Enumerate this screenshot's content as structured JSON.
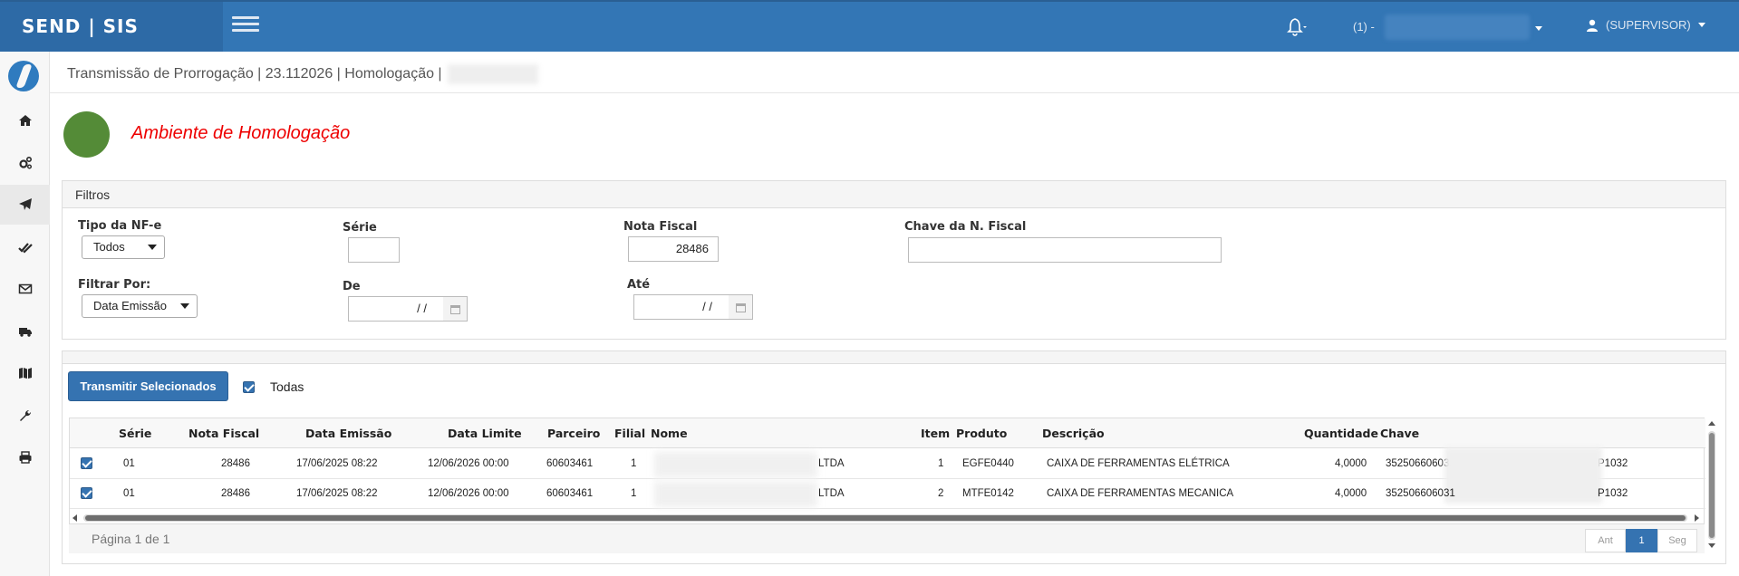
{
  "header": {
    "brand": "SEND | SIS",
    "unit_label": "(1) -",
    "user_label": "(SUPERVISOR)"
  },
  "sidebar": {
    "items": [
      {
        "icon": "home-icon"
      },
      {
        "icon": "cogs-icon"
      },
      {
        "icon": "paper-plane-icon"
      },
      {
        "icon": "double-check-icon"
      },
      {
        "icon": "envelope-icon"
      },
      {
        "icon": "truck-icon"
      },
      {
        "icon": "map-icon"
      },
      {
        "icon": "wrench-icon"
      },
      {
        "icon": "print-icon"
      }
    ]
  },
  "breadcrumb": "Transmissão de Prorrogação | 23.112026 | Homologação |",
  "environment": {
    "title": "Ambiente de Homologação",
    "status_color": "#548b37"
  },
  "filters": {
    "heading": "Filtros",
    "tipo_nfe": {
      "label": "Tipo da NF-e",
      "value": "Todos"
    },
    "serie": {
      "label": "Série",
      "value": ""
    },
    "nota_fiscal": {
      "label": "Nota Fiscal",
      "value": "28486"
    },
    "chave": {
      "label": "Chave da N. Fiscal",
      "value": ""
    },
    "filtrar_por": {
      "label": "Filtrar Por:",
      "value": "Data Emissão"
    },
    "de": {
      "label": "De",
      "value": "/ /"
    },
    "ate": {
      "label": "Até",
      "value": "/ /"
    }
  },
  "actions": {
    "transmit_label": "Transmitir Selecionados",
    "select_all_label": "Todas"
  },
  "grid": {
    "columns": [
      "Série",
      "Nota Fiscal",
      "Data Emissão",
      "Data Limite",
      "Parceiro",
      "Filial",
      "Nome",
      "Item",
      "Produto",
      "Descrição",
      "Quantidade",
      "Chave"
    ],
    "rows": [
      {
        "serie": "01",
        "nota": "28486",
        "emissao": "17/06/2025 08:22",
        "limite": "12/06/2026 00:00",
        "parceiro": "60603461",
        "filial": "1",
        "nome": "LTDA",
        "item": "1",
        "produto": "EGFE0440",
        "descricao": "CAIXA DE FERRAMENTAS ELÉTRICA",
        "quantidade": "4,0000",
        "chave_a": "352506606031",
        "chave_b": "P1032"
      },
      {
        "serie": "01",
        "nota": "28486",
        "emissao": "17/06/2025 08:22",
        "limite": "12/06/2026 00:00",
        "parceiro": "60603461",
        "filial": "1",
        "nome": "LTDA",
        "item": "2",
        "produto": "MTFE0142",
        "descricao": "CAIXA DE FERRAMENTAS MECANICA",
        "quantidade": "4,0000",
        "chave_a": "352506606031",
        "chave_b": "P1032"
      }
    ]
  },
  "pager": {
    "info": "Página 1 de 1",
    "prev": "Ant",
    "current": "1",
    "next": "Seg"
  }
}
